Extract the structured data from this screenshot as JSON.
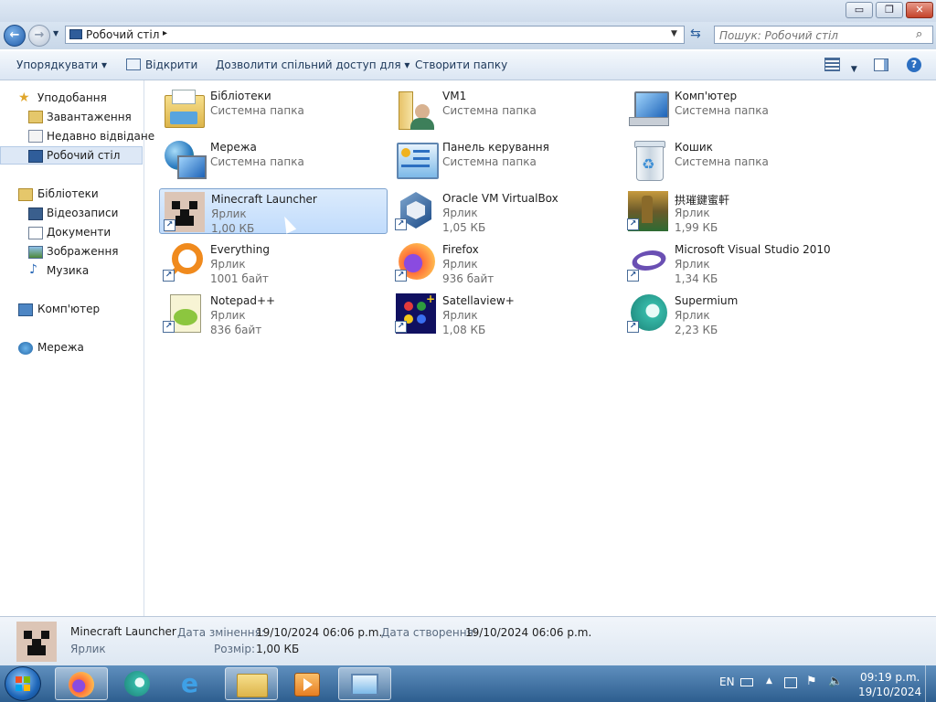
{
  "address": {
    "location": "Робочий стіл"
  },
  "search": {
    "placeholder": "Пошук: Робочий стіл"
  },
  "window_controls": {
    "minimize": "▭",
    "restore": "❐",
    "close": "✕"
  },
  "toolbar": {
    "organize": "Упорядкувати",
    "open": "Відкрити",
    "share": "Дозволити спільний доступ для",
    "new_folder": "Створити папку"
  },
  "nav": {
    "favorites": "Уподобання",
    "downloads": "Завантаження",
    "recent": "Недавно відвідане",
    "desktop": "Робочий стіл",
    "libraries": "Бібліотеки",
    "videos": "Відеозаписи",
    "documents": "Документи",
    "pictures": "Зображення",
    "music": "Музика",
    "computer": "Комп'ютер",
    "network": "Мережа"
  },
  "items": [
    {
      "name": "Бібліотеки",
      "type": "Системна папка",
      "size": "",
      "icon": "libraries-icon"
    },
    {
      "name": "VM1",
      "type": "Системна папка",
      "size": "",
      "icon": "user-folder-icon"
    },
    {
      "name": "Комп'ютер",
      "type": "Системна папка",
      "size": "",
      "icon": "computer-icon"
    },
    {
      "name": "Мережа",
      "type": "Системна папка",
      "size": "",
      "icon": "network-icon"
    },
    {
      "name": "Панель керування",
      "type": "Системна папка",
      "size": "",
      "icon": "control-panel-icon"
    },
    {
      "name": "Кошик",
      "type": "Системна папка",
      "size": "",
      "icon": "recycle-bin-icon"
    },
    {
      "name": "Minecraft Launcher",
      "type": "Ярлик",
      "size": "1,00 КБ",
      "icon": "minecraft-icon"
    },
    {
      "name": "Oracle VM VirtualBox",
      "type": "Ярлик",
      "size": "1,05 КБ",
      "icon": "virtualbox-icon"
    },
    {
      "name": "拱璀鍵蜜軒",
      "type": "Ярлик",
      "size": "1,99 КБ",
      "icon": "game-icon"
    },
    {
      "name": "Everything",
      "type": "Ярлик",
      "size": "1001 байт",
      "icon": "everything-icon"
    },
    {
      "name": "Firefox",
      "type": "Ярлик",
      "size": "936 байт",
      "icon": "firefox-icon"
    },
    {
      "name": "Microsoft Visual Studio 2010",
      "type": "Ярлик",
      "size": "1,34 КБ",
      "icon": "visual-studio-icon"
    },
    {
      "name": "Notepad++",
      "type": "Ярлик",
      "size": "836 байт",
      "icon": "notepadpp-icon"
    },
    {
      "name": "Satellaview+",
      "type": "Ярлик",
      "size": "1,08 КБ",
      "icon": "satellaview-icon"
    },
    {
      "name": "Supermium",
      "type": "Ярлик",
      "size": "2,23 КБ",
      "icon": "supermium-icon"
    }
  ],
  "details": {
    "name": "Minecraft Launcher",
    "type": "Ярлик",
    "modified_label": "Дата змінення:",
    "modified_value": "19/10/2024 06:06 p.m.",
    "created_label": "Дата створення:",
    "created_value": "19/10/2024 06:06 p.m.",
    "size_label": "Розмір:",
    "size_value": "1,00 КБ"
  },
  "taskbar": {
    "lang": "EN",
    "time": "09:19 p.m.",
    "date": "19/10/2024"
  },
  "colors": {
    "selection": "#c1dcfc",
    "accent": "#1e395b",
    "taskbar": "#3a6ea5"
  }
}
